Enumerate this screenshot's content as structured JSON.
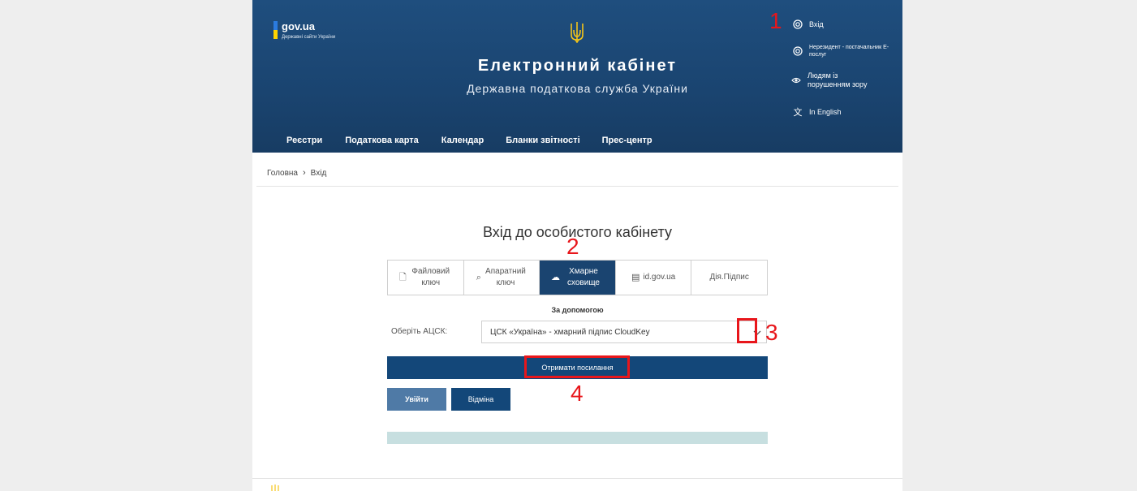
{
  "header": {
    "logo_name": "gov.ua",
    "logo_sub": "Державні сайти України",
    "title": "Електронний кабінет",
    "subtitle": "Державна податкова служба України",
    "side_links": [
      {
        "label": "Вхід",
        "icon": "fingerprint-icon"
      },
      {
        "label": "Нерезидент - постачальник Е-послуг",
        "icon": "fingerprint-icon"
      },
      {
        "label": "Людям із порушенням зору",
        "icon": "eye-icon"
      },
      {
        "label": "In English",
        "icon": "translate-icon"
      }
    ],
    "nav": [
      "Реєстри",
      "Податкова карта",
      "Календар",
      "Бланки звітності",
      "Прес-центр"
    ]
  },
  "breadcrumb": {
    "home": "Головна",
    "current": "Вхід"
  },
  "login": {
    "heading": "Вхід до особистого кабінету",
    "tabs": [
      {
        "label": "Файловий ключ",
        "icon": "file-icon",
        "active": false
      },
      {
        "label": "Апаратний ключ",
        "icon": "key-icon",
        "active": false
      },
      {
        "label": "Хмарне сховище",
        "icon": "cloud-icon",
        "active": true
      },
      {
        "label": "id.gov.ua",
        "icon": "id-card-icon",
        "active": false
      },
      {
        "label": "Дія.Підпис",
        "icon": "",
        "active": false
      }
    ],
    "help": "За допомогою",
    "acsk_label": "Оберіть АЦСК:",
    "acsk_value": "ЦСК «Україна» - хмарний підпис CloudKey",
    "get_link": "Отримати посилання",
    "login_btn": "Увійти",
    "cancel_btn": "Відміна"
  },
  "annotations": [
    "1",
    "2",
    "3",
    "4"
  ],
  "colors": {
    "header": "#1a4470",
    "accent": "#134779",
    "annotation": "#e8161b",
    "info": "#c7dfe0"
  }
}
